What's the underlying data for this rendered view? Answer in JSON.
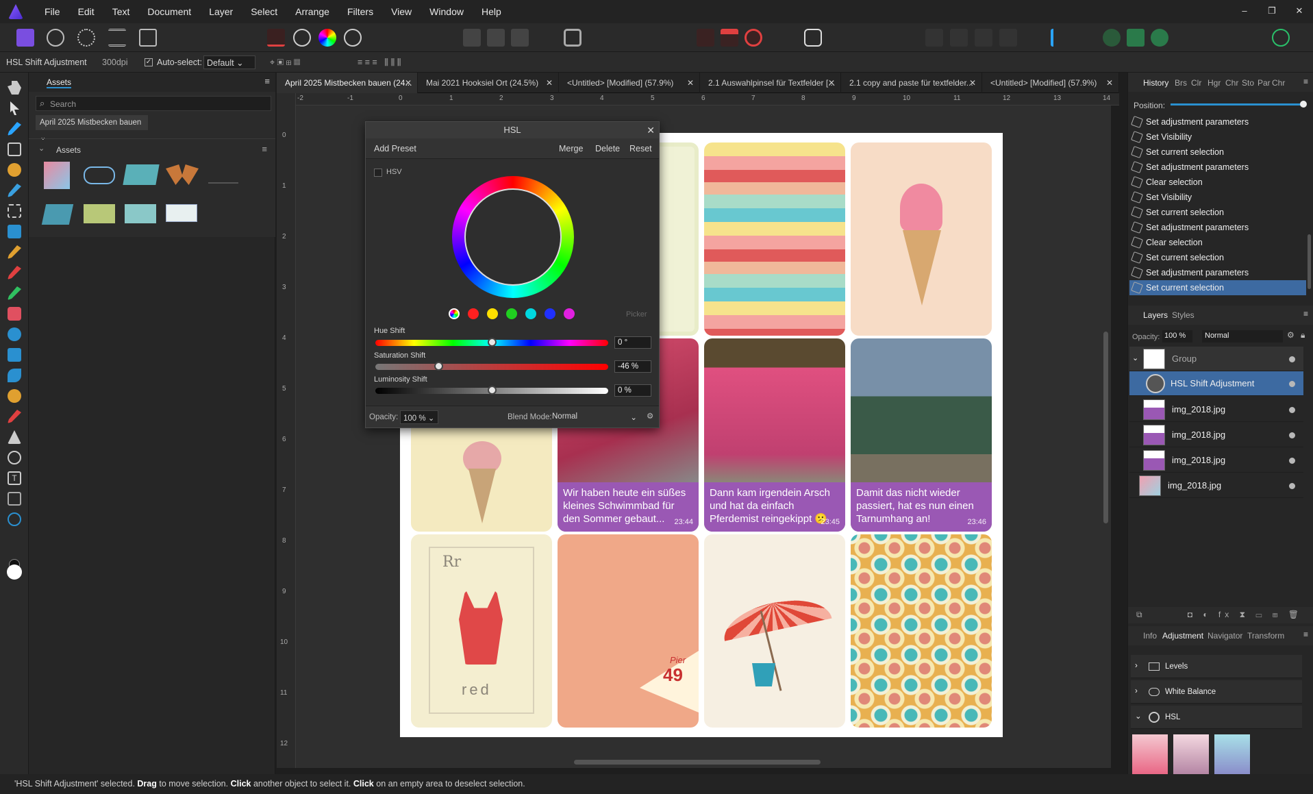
{
  "menu": [
    "File",
    "Edit",
    "Text",
    "Document",
    "Layer",
    "Select",
    "Arrange",
    "Filters",
    "View",
    "Window",
    "Help"
  ],
  "window_controls": [
    "–",
    "❐",
    "✕"
  ],
  "context": {
    "selection": "HSL Shift Adjustment",
    "dpi": "300dpi",
    "autoselect_label": "Auto-select:",
    "autoselect_value": "Default"
  },
  "assets": {
    "tab": "Assets",
    "search_placeholder": "Search",
    "category": "April 2025 Mistbecken bauen",
    "section": "Assets"
  },
  "doc_tabs": [
    {
      "label": "April 2025 Mistbecken bauen (24..."
    },
    {
      "label": "Mai 2021 Hooksiel Ort (24.5%)"
    },
    {
      "label": "<Untitled> [Modified] (57.9%)"
    },
    {
      "label": "2.1 Auswahlpinsel für Textfelder [..."
    },
    {
      "label": "2.1 copy and paste für textfelder..."
    },
    {
      "label": "<Untitled> [Modified] (57.9%)"
    }
  ],
  "ruler_h": [
    "-2",
    "-1",
    "0",
    "1",
    "2",
    "3",
    "4",
    "5",
    "6",
    "7",
    "8",
    "9",
    "10",
    "11",
    "12",
    "13",
    "14"
  ],
  "ruler_v": [
    "0",
    "1",
    "2",
    "3",
    "4",
    "5",
    "6",
    "7",
    "8",
    "9",
    "10",
    "11",
    "12"
  ],
  "cards": {
    "msg1": {
      "text": "Wir haben heute ein süßes kleines Schwimmbad für den Sommer gebaut...",
      "time": "23:44"
    },
    "msg2": {
      "text": "Dann kam irgendein Arsch und hat da einfach Pferdemist reingekippt 😕",
      "time": "23:45"
    },
    "msg3": {
      "text": "Damit das nicht wieder passiert, hat es nun einen Tarnumhang an!",
      "time": "23:46"
    },
    "swim_top": "Rr",
    "swim_bottom": "red",
    "pier": "Pier",
    "pier_num": "49"
  },
  "hsl": {
    "title": "HSL",
    "add_preset": "Add Preset",
    "merge": "Merge",
    "delete": "Delete",
    "reset": "Reset",
    "hsv": "HSV",
    "picker": "Picker",
    "hue_label": "Hue Shift",
    "hue_value": "0 °",
    "hue_pos": 0.5,
    "sat_label": "Saturation Shift",
    "sat_value": "-46 %",
    "sat_pos": 0.27,
    "lum_label": "Luminosity Shift",
    "lum_value": "0 %",
    "lum_pos": 0.5,
    "opacity_label": "Opacity:",
    "opacity_value": "100 %",
    "blend_label": "Blend Mode:",
    "blend_value": "Normal",
    "swatches": [
      "#ff2020",
      "#ffe000",
      "#20d020",
      "#00d8e0",
      "#2030ff",
      "#e020e0"
    ]
  },
  "history": {
    "tabs": [
      "History",
      "Brs",
      "Clr",
      "Hgr",
      "Chr",
      "Sto",
      "Par",
      "Chr"
    ],
    "position_label": "Position:",
    "items": [
      "Set adjustment parameters",
      "Set Visibility",
      "Set current selection",
      "Set adjustment parameters",
      "Clear selection",
      "Set Visibility",
      "Set current selection",
      "Set adjustment parameters",
      "Clear selection",
      "Set current selection",
      "Set adjustment parameters",
      "Set current selection"
    ]
  },
  "layers": {
    "tabs": [
      "Layers",
      "Styles"
    ],
    "opacity_label": "Opacity:",
    "opacity_value": "100 %",
    "blend": "Normal",
    "items": [
      "Group",
      "HSL Shift Adjustment",
      "img_2018.jpg",
      "img_2018.jpg",
      "img_2018.jpg",
      "img_2018.jpg"
    ]
  },
  "bottom_tabs": [
    "Info",
    "Adjustment",
    "Navigator",
    "Transform"
  ],
  "adjustments": [
    "Levels",
    "White Balance",
    "HSL"
  ],
  "status": {
    "a": "'HSL Shift Adjustment' selected. ",
    "b": "Drag",
    "c": " to move selection. ",
    "d": "Click",
    "e": " another object to select it. ",
    "f": "Click",
    "g": " on an empty area to deselect selection."
  }
}
